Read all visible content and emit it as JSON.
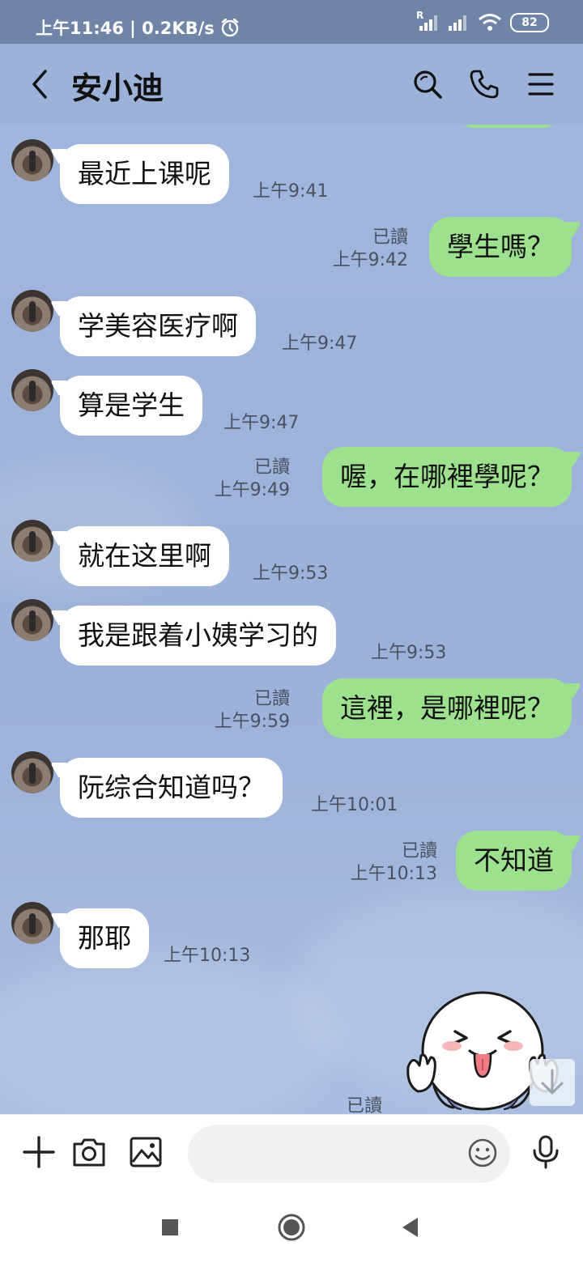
{
  "status_bar": {
    "time_speed": "上午11:46 | 0.2KB/s",
    "battery": "82",
    "roaming_label": "R"
  },
  "header": {
    "contact_name": "安小迪"
  },
  "messages": [
    {
      "dir": "in",
      "text": "最近上课呢",
      "time": "上午9:41"
    },
    {
      "dir": "out",
      "text": "學生嗎？",
      "read": "已讀",
      "time": "上午9:42"
    },
    {
      "dir": "in",
      "text": "学美容医疗啊",
      "time": "上午9:47"
    },
    {
      "dir": "in",
      "text": "算是学生",
      "time": "上午9:47"
    },
    {
      "dir": "out",
      "text": "喔，在哪裡學呢？",
      "read": "已讀",
      "time": "上午9:49"
    },
    {
      "dir": "in",
      "text": "就在这里啊",
      "time": "上午9:53"
    },
    {
      "dir": "in",
      "text": "我是跟着小姨学习的",
      "time": "上午9:53"
    },
    {
      "dir": "out",
      "text": "這裡，是哪裡呢？",
      "read": "已讀",
      "time": "上午9:59"
    },
    {
      "dir": "in",
      "text": "阮综合知道吗？",
      "time": "上午10:01"
    },
    {
      "dir": "out",
      "text": "不知道",
      "read": "已讀",
      "time": "上午10:13"
    },
    {
      "dir": "in",
      "text": "那耶",
      "time": "上午10:13"
    }
  ],
  "last_sticker_read": "已讀",
  "input": {
    "placeholder": ""
  },
  "colors": {
    "chat_bg": "#9db2d9",
    "bubble_out": "#9de08e",
    "bubble_in": "#ffffff",
    "status_bar": "#6f84a6"
  }
}
